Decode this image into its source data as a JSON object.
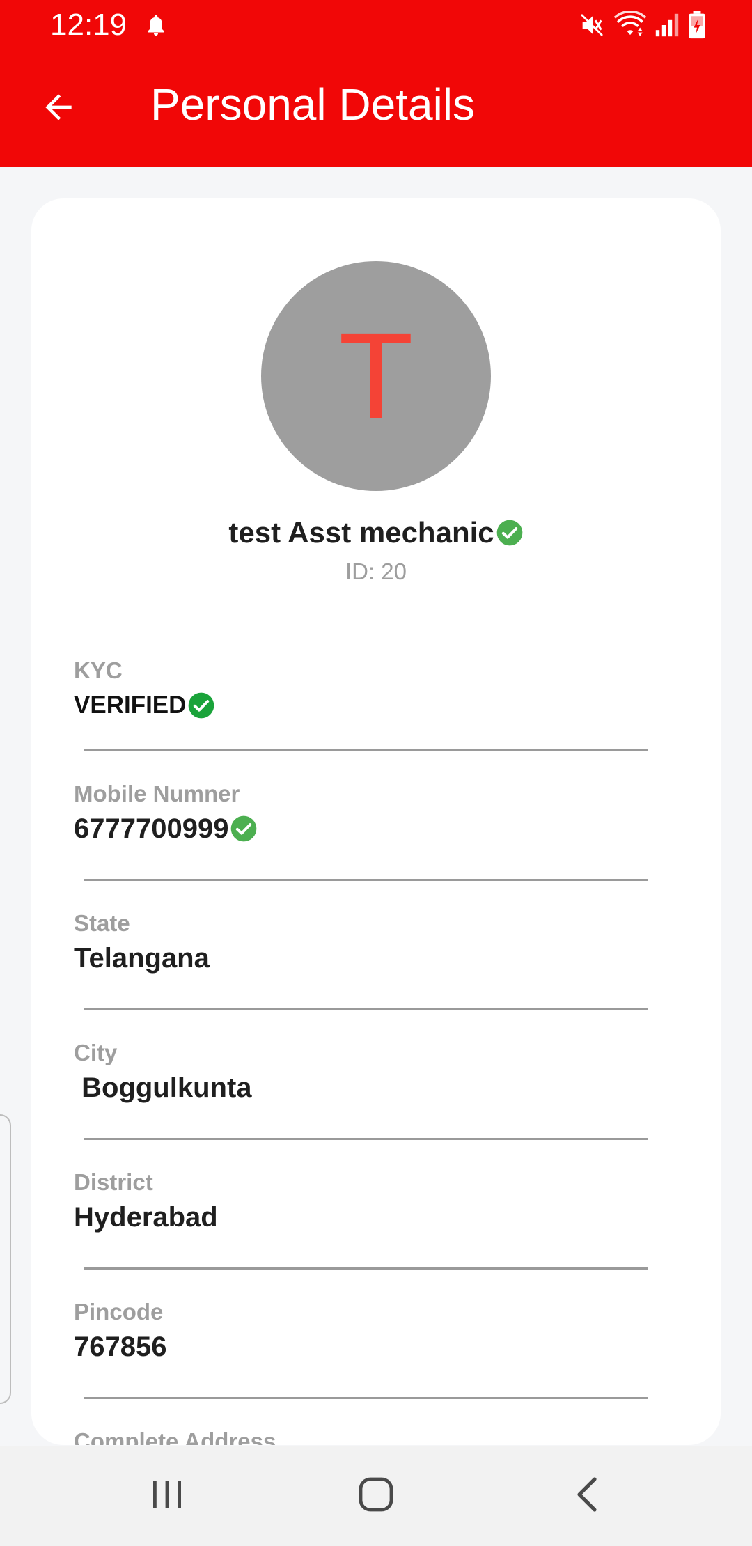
{
  "status_bar": {
    "time": "12:19",
    "icons": [
      "bell-icon",
      "mute-icon",
      "wifi-icon",
      "signal-icon",
      "battery-icon"
    ],
    "battery_level": "7"
  },
  "app_bar": {
    "title": "Personal Details",
    "back_icon": "arrow-left-icon",
    "color": "#f10707"
  },
  "profile": {
    "initial": "T",
    "name": "test Asst mechanic",
    "id_text": "ID: 20",
    "avatar_color": "#9e9e9e",
    "initial_color": "#f44336"
  },
  "fields": [
    {
      "label": "KYC",
      "value": "VERIFIED",
      "verified": true
    },
    {
      "label": "Mobile Numner",
      "value": "6777700999",
      "verified": true
    },
    {
      "label": "State",
      "value": "Telangana"
    },
    {
      "label": "City",
      "value": " Boggulkunta"
    },
    {
      "label": "District",
      "value": "Hyderabad"
    },
    {
      "label": "Pincode",
      "value": "767856"
    },
    {
      "label": "Complete Address",
      "value": ""
    }
  ],
  "colors": {
    "verified_green": "#4caf50",
    "kyc_green": "#1aa33a"
  },
  "nav_bar": {
    "icons": [
      "recents-icon",
      "home-icon",
      "back-icon"
    ]
  }
}
